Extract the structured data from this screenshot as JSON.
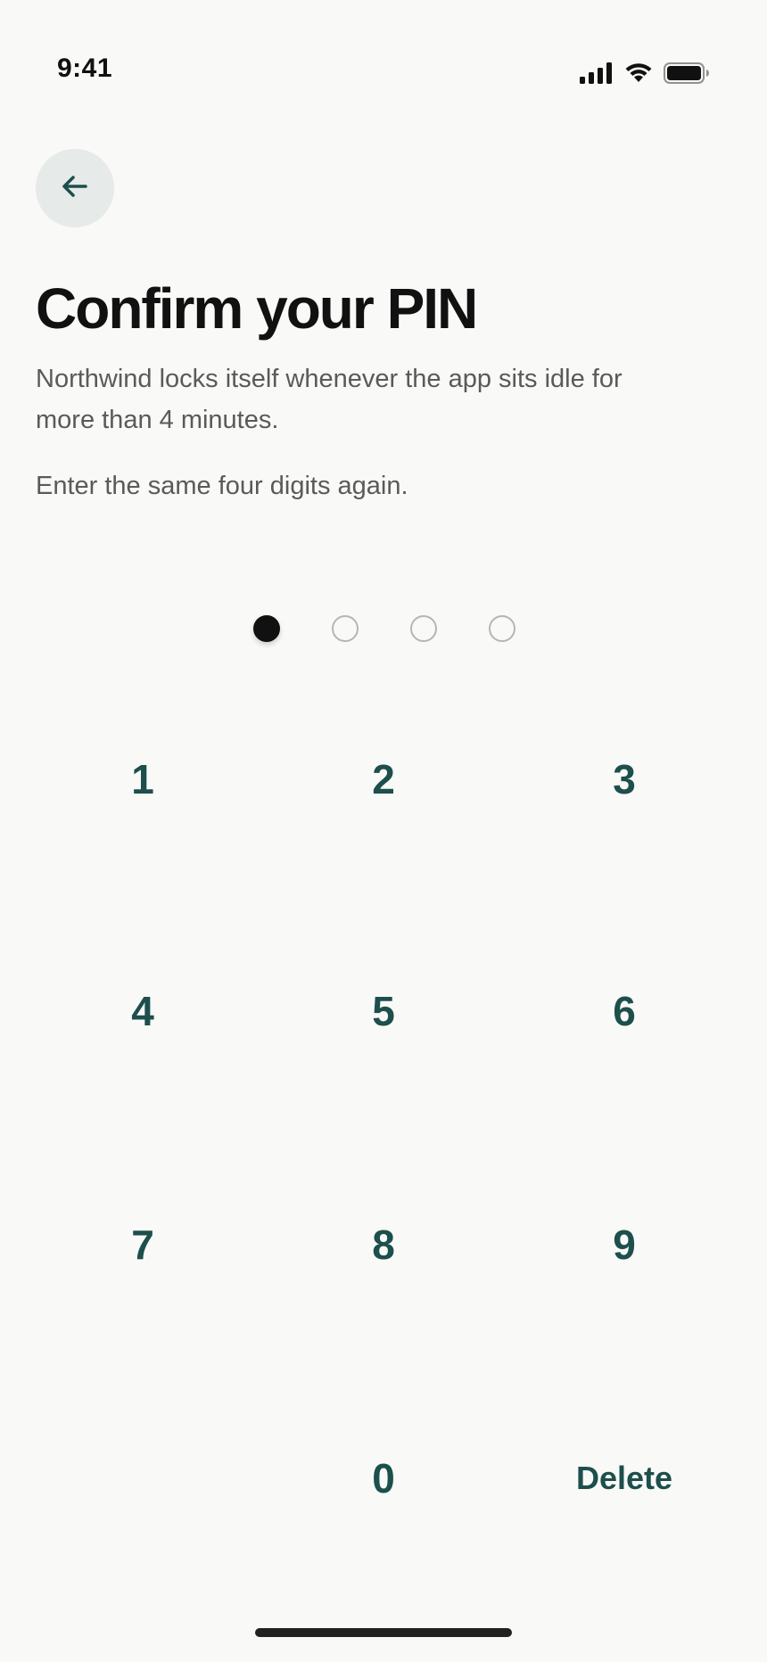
{
  "status_bar": {
    "time": "9:41",
    "icons": [
      "signal-icon",
      "wifi-icon",
      "battery-icon"
    ]
  },
  "header": {
    "back_icon": "arrow-left-icon",
    "title": "Confirm your PIN"
  },
  "body": {
    "description": "Northwind locks itself whenever the app sits idle for more than 4 minutes.",
    "instruction": "Enter the same four digits again."
  },
  "pin": {
    "length": 4,
    "filled": 1
  },
  "keypad": {
    "keys": [
      "1",
      "2",
      "3",
      "4",
      "5",
      "6",
      "7",
      "8",
      "9",
      "0"
    ],
    "delete_label": "Delete"
  },
  "colors": {
    "accent": "#1d4f4c",
    "background": "#f9f9f7",
    "text_primary": "#111111",
    "text_secondary": "#5a5a5a",
    "back_button_bg": "#e6eae8"
  }
}
